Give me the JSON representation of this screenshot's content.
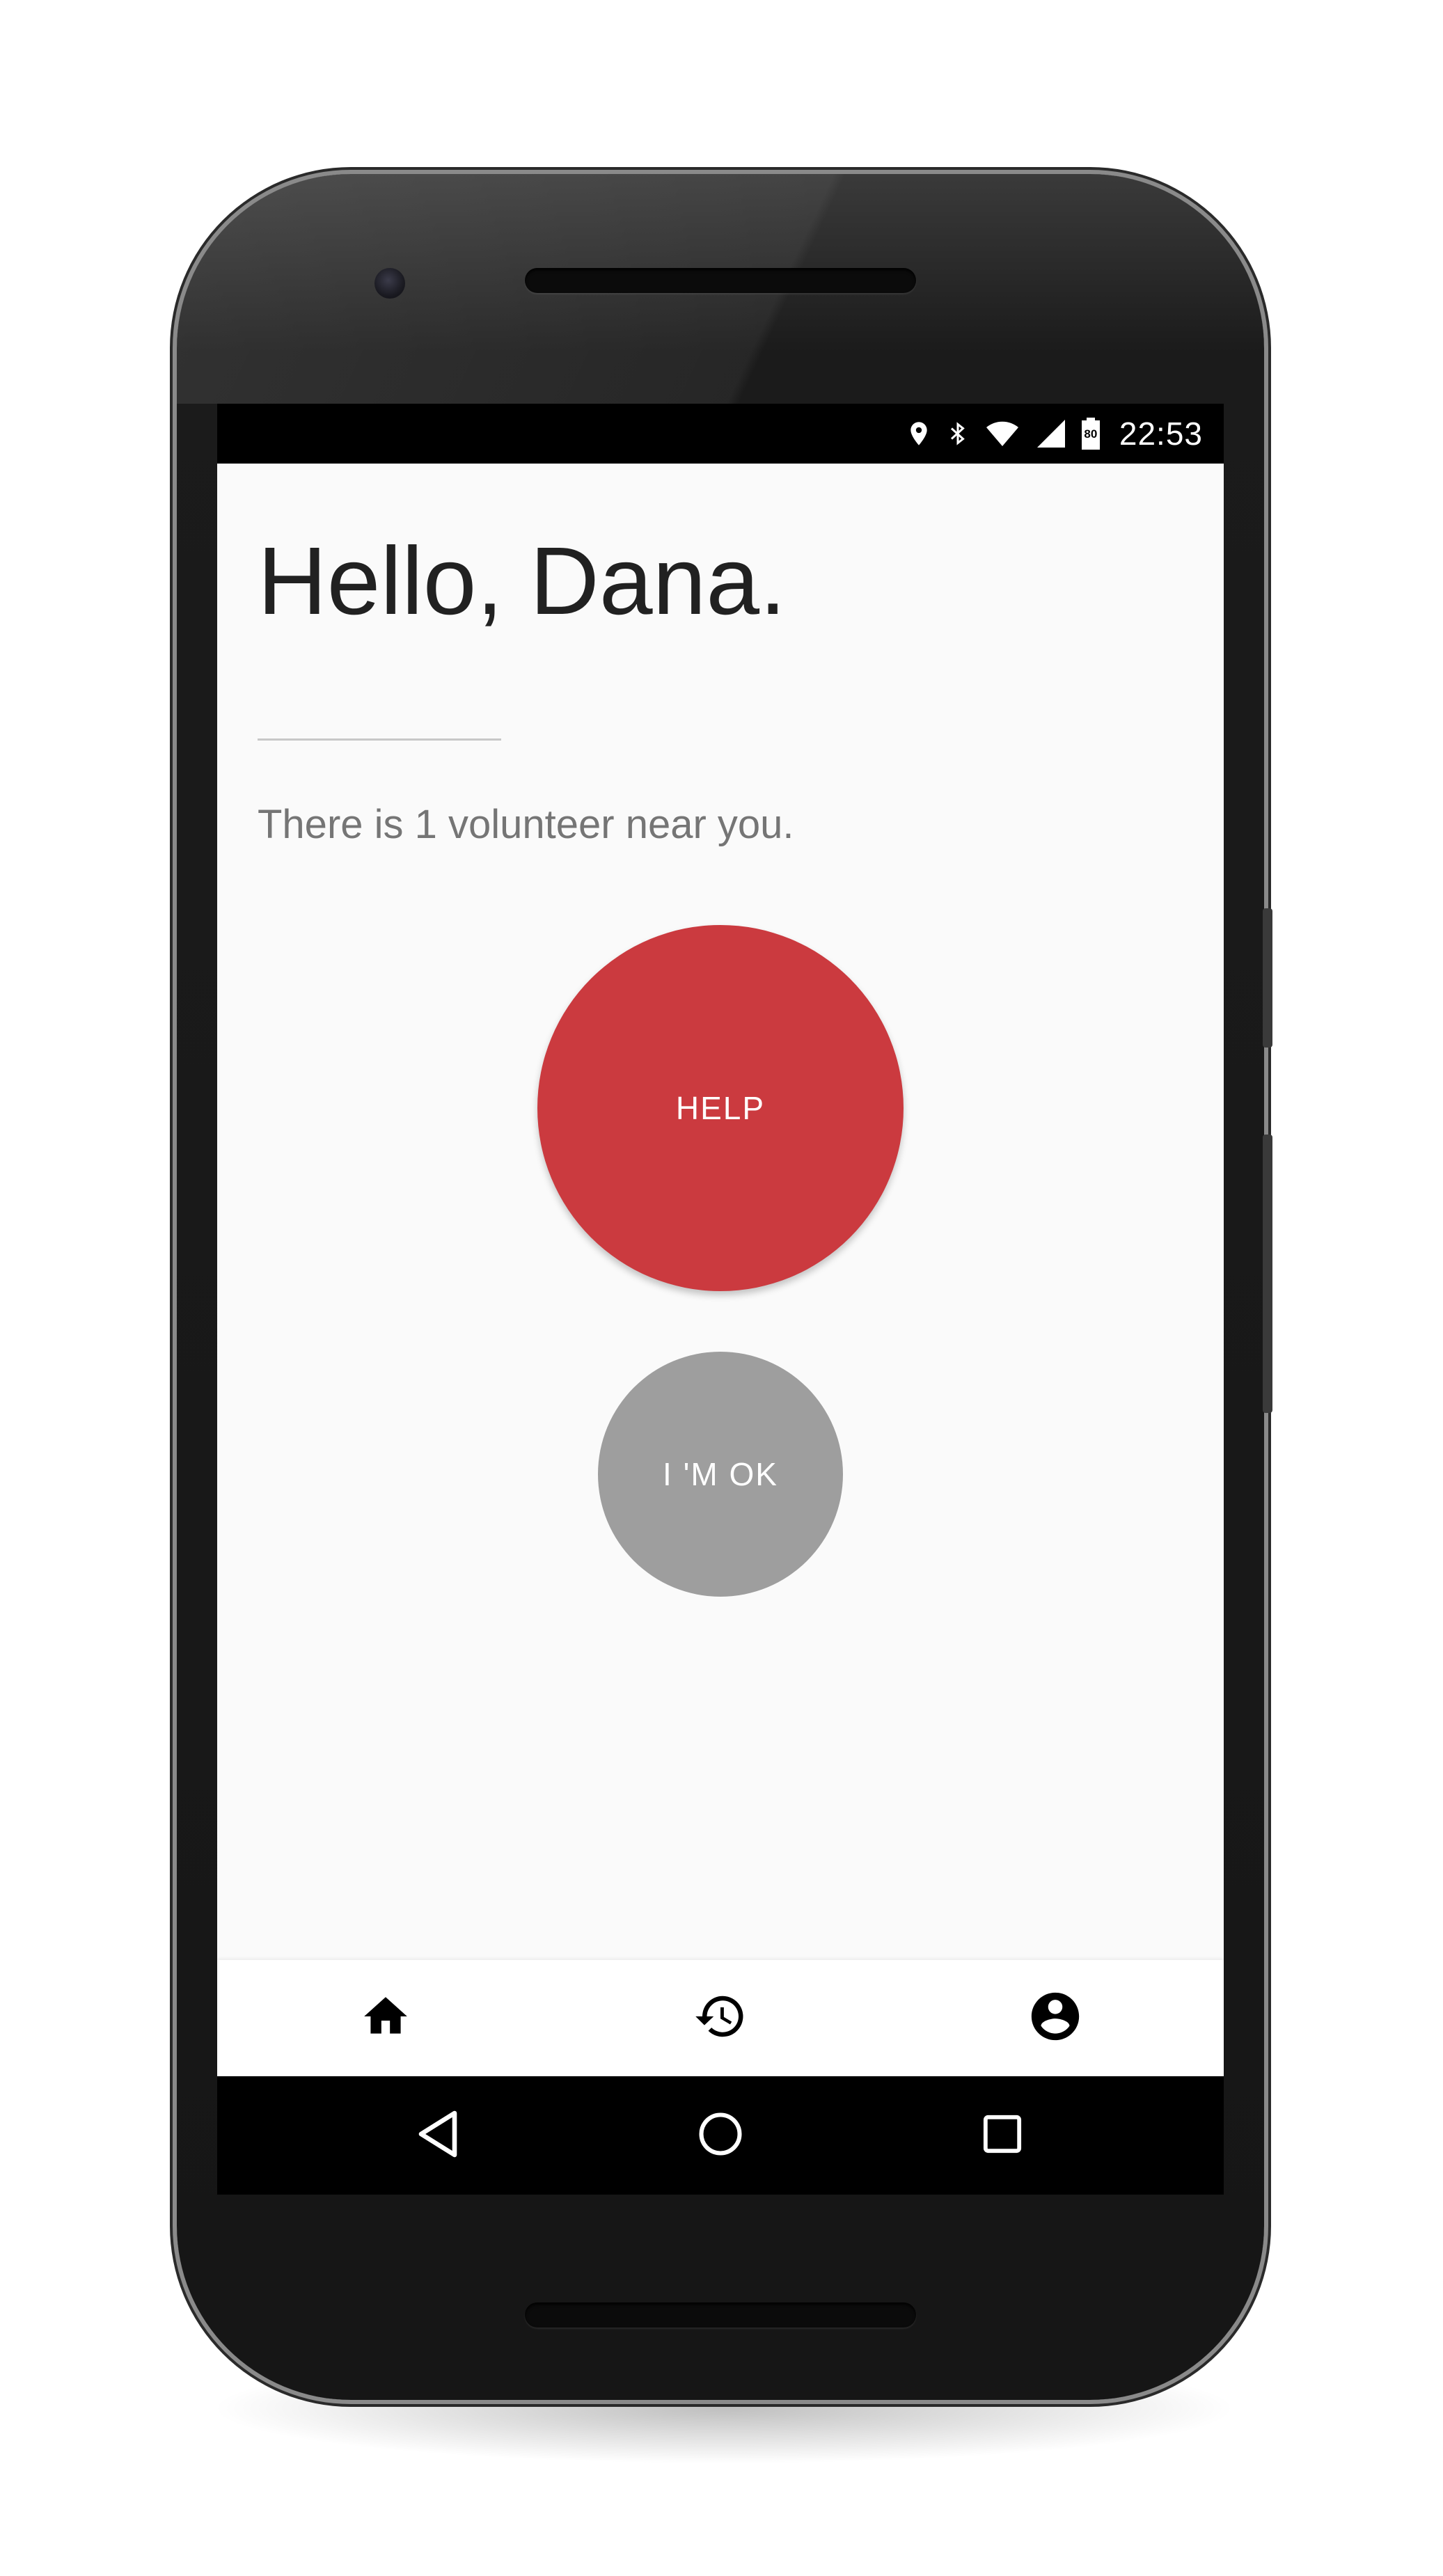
{
  "status_bar": {
    "time": "22:53",
    "battery_level": "80",
    "icons": [
      "location-icon",
      "bluetooth-icon",
      "wifi-icon",
      "signal-icon",
      "battery-icon"
    ]
  },
  "main": {
    "greeting": "Hello, Dana.",
    "volunteer_text": "There is 1 volunteer near you.",
    "help_button_label": "HELP",
    "ok_button_label": "I 'M OK"
  },
  "bottom_nav": {
    "items": [
      {
        "icon": "home-icon",
        "active": true
      },
      {
        "icon": "history-icon",
        "active": false
      },
      {
        "icon": "account-icon",
        "active": false
      }
    ]
  },
  "system_nav": {
    "buttons": [
      "back-icon",
      "home-circle-icon",
      "recents-icon"
    ]
  },
  "colors": {
    "help": "#cb3a3f",
    "ok": "#9e9e9e",
    "text_primary": "#212121",
    "text_secondary": "#757575",
    "background": "#fafafa"
  }
}
